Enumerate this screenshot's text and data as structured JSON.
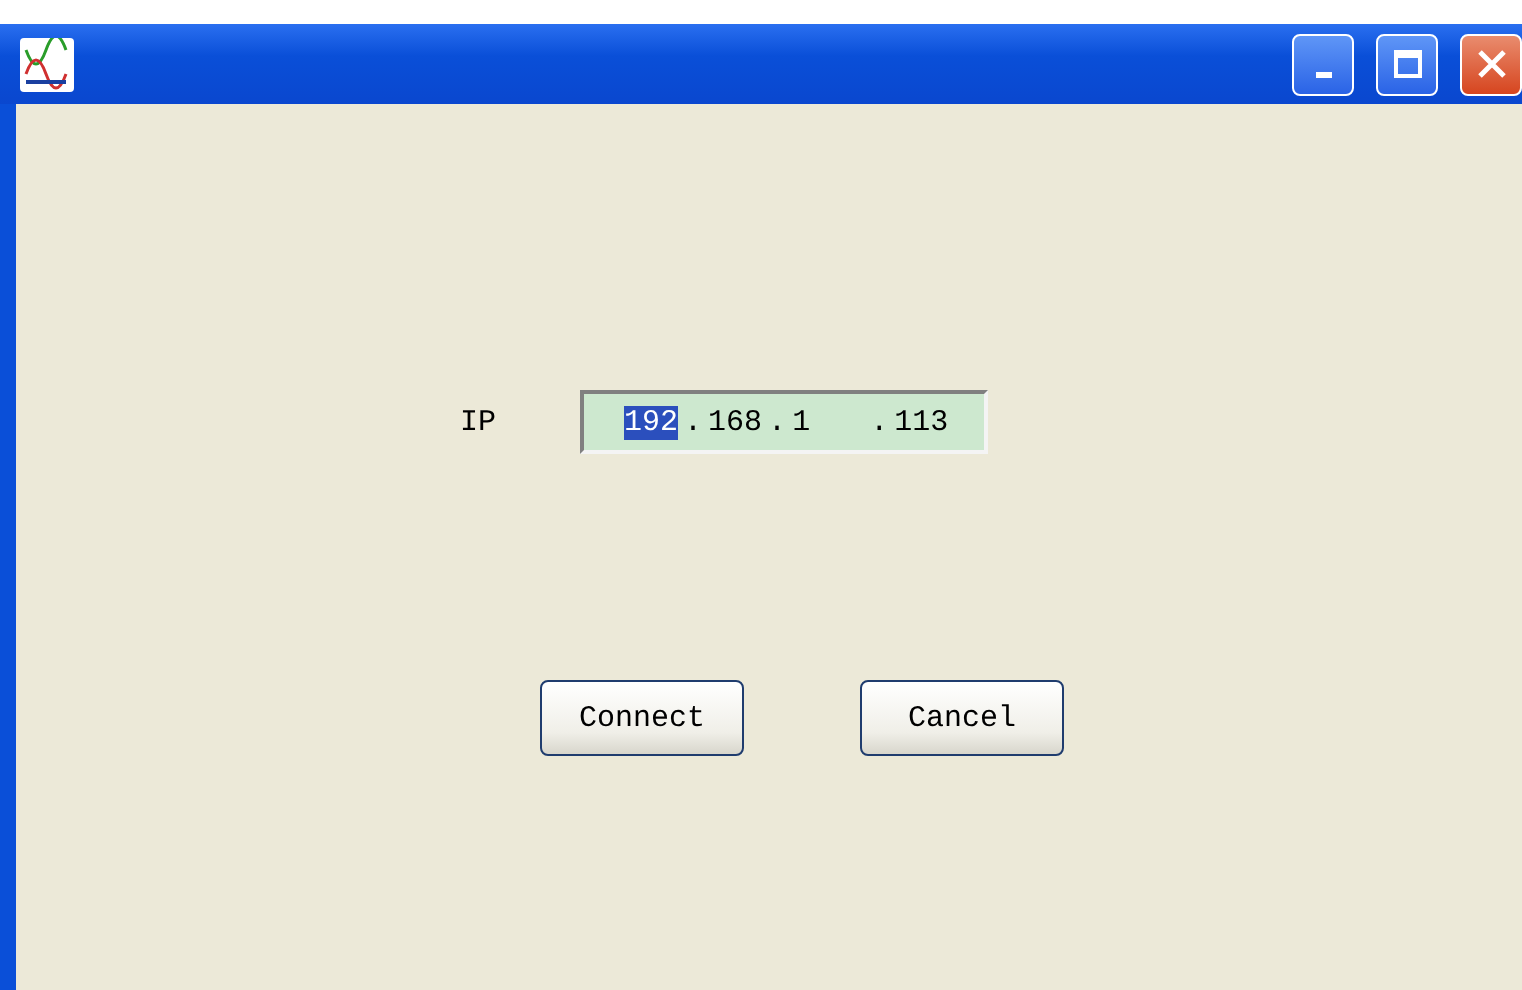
{
  "ip": {
    "label": "IP",
    "segments": [
      {
        "kind": "octet",
        "text": "192",
        "selected": true
      },
      {
        "kind": "dot",
        "text": "."
      },
      {
        "kind": "octet",
        "text": "168",
        "selected": false
      },
      {
        "kind": "dot",
        "text": "."
      },
      {
        "kind": "octet",
        "text": "1",
        "selected": false
      },
      {
        "kind": "dot",
        "text": "."
      },
      {
        "kind": "octet",
        "text": "113",
        "selected": false
      }
    ]
  },
  "buttons": [
    "Connect",
    "Cancel"
  ]
}
